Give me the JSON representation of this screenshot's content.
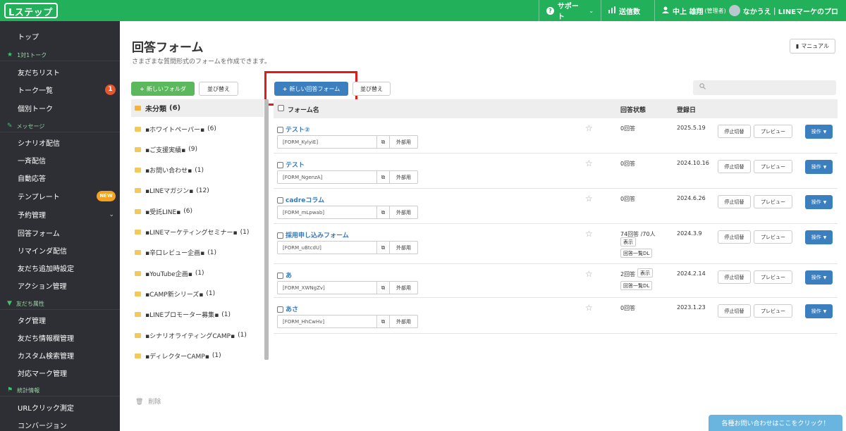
{
  "app": {
    "logo": "Lステップ",
    "brand_color": "#22b05a",
    "sidebar_color": "#2d2f34",
    "accent_blue": "#3c7fbf"
  },
  "topnav": {
    "support": "サポート",
    "support_icon": "question-circle-icon",
    "sends": "送信数",
    "sends_icon": "bar-chart-icon",
    "user_name": "中上 雄翔",
    "user_role": "(管理者)",
    "account": "なかうえ｜LINEマーケのプロ"
  },
  "sidebar": {
    "items": [
      {
        "type": "item",
        "label": "トップ"
      },
      {
        "type": "section",
        "label": "1対1トーク",
        "icon": "star-icon"
      },
      {
        "type": "item",
        "label": "友だちリスト"
      },
      {
        "type": "item",
        "label": "トーク一覧",
        "badge": "1"
      },
      {
        "type": "item",
        "label": "個別トーク"
      },
      {
        "type": "section",
        "label": "メッセージ",
        "icon": "megaphone-icon"
      },
      {
        "type": "item",
        "label": "シナリオ配信"
      },
      {
        "type": "item",
        "label": "一斉配信"
      },
      {
        "type": "item",
        "label": "自動応答"
      },
      {
        "type": "item",
        "label": "テンプレート",
        "badge_new": "NEW"
      },
      {
        "type": "item",
        "label": "予約管理",
        "chevron": "⌄"
      },
      {
        "type": "item",
        "label": "回答フォーム"
      },
      {
        "type": "item",
        "label": "リマインダ配信"
      },
      {
        "type": "item",
        "label": "友だち追加時設定"
      },
      {
        "type": "item",
        "label": "アクション管理"
      },
      {
        "type": "section",
        "label": "友だち属性",
        "icon": "filter-icon"
      },
      {
        "type": "item",
        "label": "タグ管理"
      },
      {
        "type": "item",
        "label": "友だち情報欄管理"
      },
      {
        "type": "item",
        "label": "カスタム検索管理"
      },
      {
        "type": "item",
        "label": "対応マーク管理"
      },
      {
        "type": "section",
        "label": "統計情報",
        "icon": "flag-icon"
      },
      {
        "type": "item",
        "label": "URLクリック測定"
      },
      {
        "type": "item",
        "label": "コンバージョン"
      }
    ]
  },
  "page": {
    "title": "回答フォーム",
    "subtitle": "さまざまな質問形式のフォームを作成できます。",
    "manual": "マニュアル"
  },
  "toolbar": {
    "new_folder": "新しいフォルダ",
    "sort_folders": "並び替え",
    "new_form": "新しい回答フォーム",
    "sort_forms": "並び替え",
    "search_placeholder": ""
  },
  "folders": {
    "active": {
      "name": "未分類",
      "count": "(6)"
    },
    "items": [
      {
        "name": "▪ホワイトペーパー▪",
        "count": "(6)"
      },
      {
        "name": "▪ご支援実績▪",
        "count": "(9)"
      },
      {
        "name": "▪お問い合わせ▪",
        "count": "(1)"
      },
      {
        "name": "▪LINEマガジン▪",
        "count": "(12)"
      },
      {
        "name": "▪受託LINE▪",
        "count": "(6)"
      },
      {
        "name": "▪LINEマーケティングセミナー▪",
        "count": "(1)"
      },
      {
        "name": "▪辛口レビュー企画▪",
        "count": "(1)"
      },
      {
        "name": "▪YouTube企画▪",
        "count": "(1)"
      },
      {
        "name": "▪CAMP新シリーズ▪",
        "count": "(1)"
      },
      {
        "name": "▪LINEプロモーター募集▪",
        "count": "(1)"
      },
      {
        "name": "▪シナリオライティングCAMP▪",
        "count": "(1)"
      },
      {
        "name": "▪ディレクターCAMP▪",
        "count": "(1)"
      }
    ],
    "delete": "削除"
  },
  "table": {
    "headers": {
      "name": "フォーム名",
      "status": "回答状態",
      "date": "登録日"
    },
    "rows": [
      {
        "name": "テスト②",
        "code": "[FORM_KylyiE]",
        "status": "0回答",
        "date": "2025.5.19"
      },
      {
        "name": "テスト",
        "code": "[FORM_NgenzA]",
        "status": "0回答",
        "date": "2024.10.16"
      },
      {
        "name": "cadreコラム",
        "code": "[FORM_mLpwab]",
        "status": "0回答",
        "date": "2024.6.26"
      },
      {
        "name": "採用申し込みフォーム",
        "code": "[FORM_uBtcdU]",
        "status": "74回答 /70人",
        "show": "表示",
        "dl": "回答一覧DL",
        "date": "2024.3.9"
      },
      {
        "name": "あ",
        "code": "[FORM_XWNgZv]",
        "status": "2回答",
        "show": "表示",
        "dl": "回答一覧DL",
        "date": "2024.2.14"
      },
      {
        "name": "あさ",
        "code": "[FORM_HhCwHv]",
        "status": "0回答",
        "date": "2023.1.23"
      }
    ],
    "external": "外部用",
    "stop": "停止切替",
    "preview": "プレビュー",
    "operation": "操作"
  },
  "contact_banner": "各種お問い合わせはここをクリック！"
}
